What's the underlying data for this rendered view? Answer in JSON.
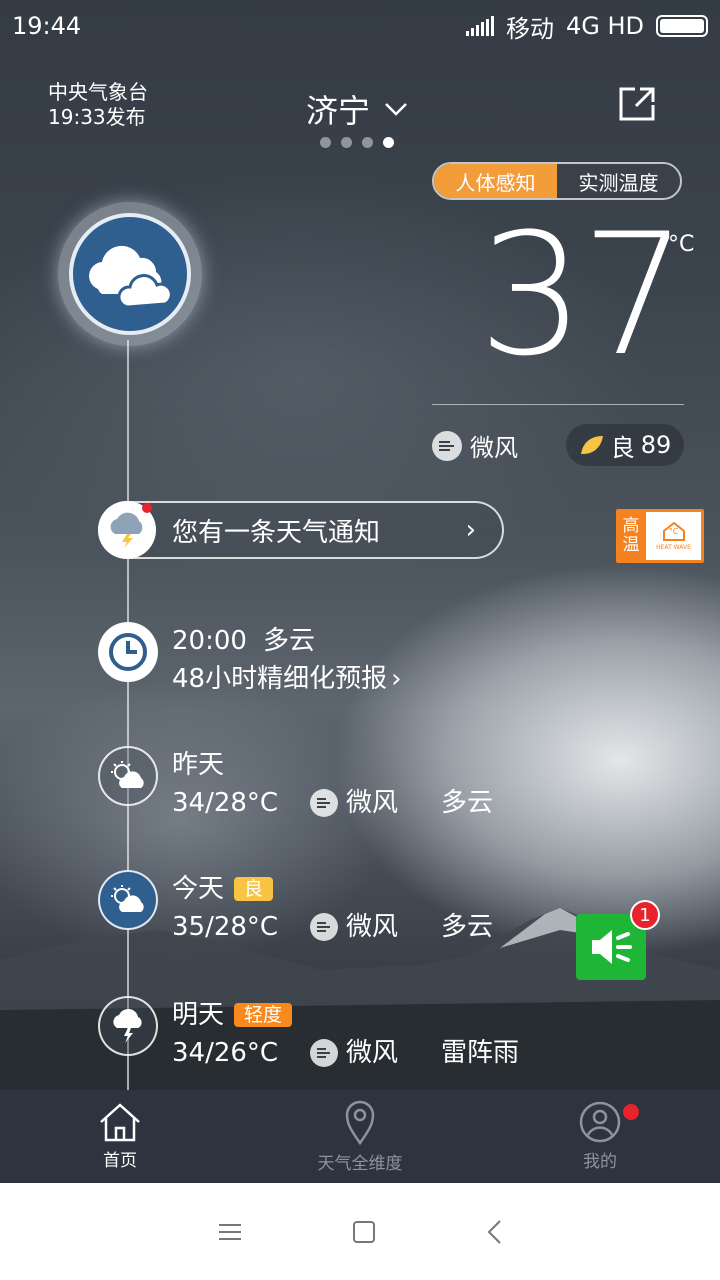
{
  "status_bar": {
    "time": "19:44",
    "carrier": "移动",
    "network": "4G HD"
  },
  "header": {
    "source": "中央气象台",
    "publish_time": "19:33发布",
    "city": "济宁",
    "page_indicator": {
      "count": 4,
      "active": 4
    }
  },
  "temperature_toggle": {
    "feel": "人体感知",
    "measured": "实测温度",
    "selected": "人体感知"
  },
  "current": {
    "temperature": "37",
    "unit": "°C",
    "wind": "微风",
    "aqi_label": "良",
    "aqi_value": "89"
  },
  "notice": {
    "text": "您有一条天气通知",
    "chevron": "›"
  },
  "heat_warning": {
    "title_line1": "高",
    "title_line2": "温",
    "caption": "HEAT WAVE",
    "icon_text": "°C"
  },
  "hourly": {
    "time": "20:00",
    "condition": "多云",
    "link": "48小时精细化预报",
    "chevron": "›"
  },
  "days": [
    {
      "label": "昨天",
      "temp": "34/28°C",
      "wind": "微风",
      "condition": "多云",
      "tag": ""
    },
    {
      "label": "今天",
      "temp": "35/28°C",
      "wind": "微风",
      "condition": "多云",
      "tag": "良"
    },
    {
      "label": "明天",
      "temp": "34/26°C",
      "wind": "微风",
      "condition": "雷阵雨",
      "tag": "轻度"
    }
  ],
  "sound_badge": "1",
  "tabs": [
    {
      "label": "首页",
      "icon": "home-icon",
      "active": true
    },
    {
      "label": "天气全维度",
      "icon": "location-pin-icon",
      "active": false
    },
    {
      "label": "我的",
      "icon": "user-icon",
      "active": false
    }
  ],
  "colors": {
    "accent": "#f39c3a",
    "good": "#f7c443",
    "mild": "#f7891f",
    "sound": "#1fb536",
    "badge": "#e8232b"
  }
}
